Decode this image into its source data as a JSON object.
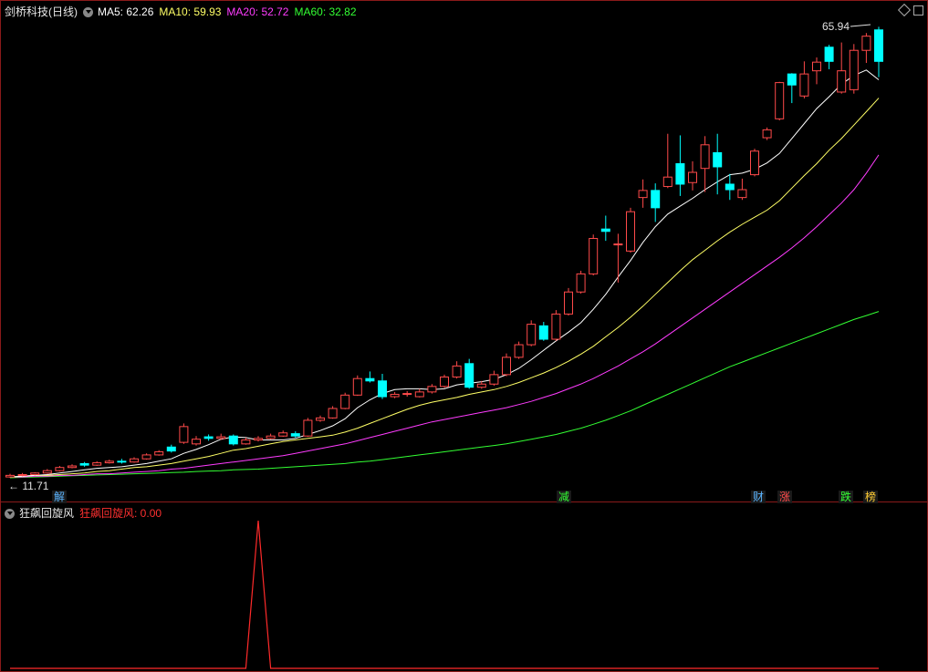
{
  "main": {
    "title": "剑桥科技(日线)",
    "ma5_text": "MA5: 62.26",
    "ma10_text": "MA10: 59.93",
    "ma20_text": "MA20: 52.72",
    "ma60_text": "MA60: 32.82",
    "high_label": "65.94",
    "low_label": "11.71",
    "colors": {
      "up": "#ff4a4a",
      "down": "#00ffff",
      "ma5": "#ffffff",
      "ma10": "#ffff66",
      "ma20": "#ff3cff",
      "ma60": "#33ff33",
      "border": "#8a1a1a"
    }
  },
  "events": [
    {
      "label": "解",
      "color": "#5ab4ff"
    },
    {
      "label": "减",
      "color": "#33ff33"
    },
    {
      "label": "财",
      "color": "#5ab4ff"
    },
    {
      "label": "涨",
      "color": "#ff4a4a"
    },
    {
      "label": "跌",
      "color": "#33ff33"
    },
    {
      "label": "榜",
      "color": "#ffcc33"
    }
  ],
  "sub": {
    "title": "狂飙回旋风",
    "value_text": "狂飙回旋风: 0.00",
    "line_color": "#ff2a2a"
  },
  "chart_data": {
    "type": "candlestick",
    "price_range": [
      11.71,
      65.94
    ],
    "candles": [
      [
        11.8,
        12.0,
        12.2,
        11.7
      ],
      [
        12.0,
        12.1,
        12.3,
        11.9
      ],
      [
        12.1,
        12.3,
        12.4,
        12.0
      ],
      [
        12.3,
        12.6,
        12.8,
        12.2
      ],
      [
        12.6,
        13.0,
        13.2,
        12.5
      ],
      [
        13.0,
        13.2,
        13.4,
        12.9
      ],
      [
        13.5,
        13.3,
        13.7,
        13.1
      ],
      [
        13.3,
        13.6,
        13.8,
        13.2
      ],
      [
        13.6,
        13.8,
        14.0,
        13.5
      ],
      [
        13.8,
        13.7,
        14.1,
        13.5
      ],
      [
        13.7,
        14.1,
        14.3,
        13.6
      ],
      [
        14.1,
        14.6,
        14.8,
        14.0
      ],
      [
        14.6,
        15.0,
        15.2,
        14.5
      ],
      [
        15.6,
        15.1,
        15.9,
        14.9
      ],
      [
        16.2,
        18.2,
        18.6,
        16.0
      ],
      [
        16.0,
        16.6,
        17.0,
        15.8
      ],
      [
        16.9,
        16.7,
        17.2,
        16.4
      ],
      [
        16.7,
        16.9,
        17.3,
        16.5
      ],
      [
        17.0,
        16.0,
        17.2,
        15.8
      ],
      [
        16.0,
        16.5,
        16.8,
        15.9
      ],
      [
        16.5,
        16.7,
        17.0,
        16.3
      ],
      [
        16.7,
        17.0,
        17.3,
        16.6
      ],
      [
        17.0,
        17.4,
        17.7,
        16.9
      ],
      [
        17.3,
        17.0,
        17.6,
        16.8
      ],
      [
        17.0,
        19.0,
        19.3,
        16.9
      ],
      [
        19.0,
        19.3,
        19.6,
        18.8
      ],
      [
        19.3,
        20.5,
        20.8,
        19.2
      ],
      [
        20.5,
        22.2,
        22.5,
        20.4
      ],
      [
        22.2,
        24.3,
        24.7,
        22.1
      ],
      [
        24.3,
        24.0,
        25.2,
        23.8
      ],
      [
        24.0,
        22.0,
        24.9,
        21.7
      ],
      [
        22.0,
        22.3,
        22.6,
        21.8
      ],
      [
        22.3,
        22.4,
        22.7,
        22.0
      ],
      [
        22.0,
        22.6,
        23.0,
        21.9
      ],
      [
        22.6,
        23.3,
        23.6,
        22.4
      ],
      [
        23.3,
        24.5,
        24.8,
        23.1
      ],
      [
        24.5,
        25.9,
        26.5,
        24.3
      ],
      [
        26.2,
        23.2,
        26.8,
        23.0
      ],
      [
        23.2,
        23.6,
        24.0,
        23.0
      ],
      [
        23.6,
        24.8,
        25.3,
        23.4
      ],
      [
        24.8,
        27.0,
        27.5,
        24.6
      ],
      [
        27.0,
        28.6,
        29.0,
        26.8
      ],
      [
        28.6,
        31.2,
        31.7,
        28.4
      ],
      [
        31.0,
        29.3,
        31.5,
        29.1
      ],
      [
        29.3,
        32.5,
        33.0,
        29.1
      ],
      [
        32.5,
        35.3,
        35.8,
        32.3
      ],
      [
        35.3,
        37.6,
        38.0,
        35.1
      ],
      [
        37.6,
        42.1,
        42.6,
        37.4
      ],
      [
        43.3,
        43.0,
        45.0,
        41.8
      ],
      [
        41.3,
        41.4,
        42.7,
        36.5
      ],
      [
        40.5,
        45.5,
        46.0,
        40.3
      ],
      [
        47.3,
        48.2,
        49.6,
        46.0
      ],
      [
        48.2,
        46.0,
        49.1,
        44.2
      ],
      [
        48.7,
        49.9,
        55.4,
        48.5
      ],
      [
        51.6,
        49.0,
        55.2,
        47.5
      ],
      [
        49.2,
        50.5,
        51.9,
        48.2
      ],
      [
        51.0,
        54.0,
        55.1,
        48.0
      ],
      [
        53.0,
        51.2,
        55.4,
        47.7
      ],
      [
        49.0,
        48.3,
        50.3,
        47.0
      ],
      [
        47.3,
        48.3,
        49.7,
        47.0
      ],
      [
        50.2,
        53.2,
        53.5,
        50.0
      ],
      [
        54.9,
        55.9,
        56.2,
        54.6
      ],
      [
        57.3,
        61.9,
        62.0,
        57.1
      ],
      [
        63.0,
        61.6,
        63.1,
        59.3
      ],
      [
        60.2,
        63.0,
        64.6,
        59.9
      ],
      [
        63.4,
        64.5,
        65.1,
        61.7
      ],
      [
        66.4,
        64.6,
        66.7,
        63.6
      ],
      [
        60.7,
        63.4,
        67.0,
        60.5
      ],
      [
        61.0,
        66.0,
        66.8,
        60.5
      ],
      [
        66.0,
        67.8,
        68.2,
        64.4
      ],
      [
        68.6,
        64.6,
        69.0,
        62.6
      ]
    ],
    "ma5": [
      11.8,
      11.9,
      12.0,
      12.1,
      12.3,
      12.5,
      12.7,
      12.9,
      13.0,
      13.1,
      13.3,
      13.5,
      13.8,
      14.1,
      14.8,
      15.3,
      15.9,
      16.6,
      16.9,
      16.8,
      16.5,
      16.5,
      16.5,
      16.7,
      17.2,
      17.7,
      18.3,
      19.2,
      20.6,
      21.6,
      22.4,
      22.9,
      23.0,
      23.0,
      22.9,
      23.0,
      23.5,
      23.7,
      23.9,
      24.2,
      24.8,
      25.6,
      26.7,
      27.9,
      29.1,
      30.2,
      31.4,
      33.1,
      35.0,
      37.2,
      39.3,
      41.6,
      43.6,
      45.2,
      46.2,
      47.2,
      48.3,
      49.3,
      50.2,
      50.4,
      50.9,
      51.7,
      52.9,
      54.8,
      56.7,
      58.6,
      60.1,
      61.7,
      62.8,
      63.5,
      62.26
    ],
    "ma10": [
      11.8,
      11.9,
      12.0,
      12.0,
      12.1,
      12.2,
      12.3,
      12.5,
      12.6,
      12.8,
      13.0,
      13.1,
      13.3,
      13.5,
      13.8,
      14.1,
      14.4,
      14.8,
      15.2,
      15.4,
      15.7,
      16.0,
      16.3,
      16.5,
      16.7,
      16.9,
      17.1,
      17.5,
      18.0,
      18.6,
      19.2,
      19.8,
      20.4,
      20.9,
      21.3,
      21.6,
      21.9,
      22.3,
      22.6,
      22.9,
      23.3,
      23.8,
      24.4,
      25.0,
      25.7,
      26.5,
      27.4,
      28.4,
      29.6,
      30.8,
      32.1,
      33.5,
      35.0,
      36.5,
      38.0,
      39.4,
      40.6,
      41.8,
      42.9,
      43.9,
      44.8,
      45.7,
      46.9,
      48.5,
      50.1,
      51.6,
      53.3,
      54.8,
      56.5,
      58.2,
      59.93
    ],
    "ma20": [
      11.8,
      11.8,
      11.9,
      11.9,
      12.0,
      12.0,
      12.1,
      12.2,
      12.2,
      12.3,
      12.4,
      12.5,
      12.6,
      12.8,
      12.9,
      13.1,
      13.3,
      13.5,
      13.7,
      13.9,
      14.1,
      14.3,
      14.5,
      14.8,
      15.1,
      15.4,
      15.7,
      16.0,
      16.4,
      16.8,
      17.2,
      17.6,
      18.0,
      18.4,
      18.8,
      19.1,
      19.4,
      19.7,
      20.0,
      20.3,
      20.6,
      21.0,
      21.4,
      21.9,
      22.4,
      23.0,
      23.6,
      24.3,
      25.1,
      25.9,
      26.8,
      27.7,
      28.7,
      29.8,
      30.9,
      32.0,
      33.1,
      34.2,
      35.3,
      36.4,
      37.5,
      38.6,
      39.7,
      40.9,
      42.2,
      43.6,
      45.1,
      46.6,
      48.3,
      50.4,
      52.72
    ],
    "ma60": [
      11.7,
      11.75,
      11.8,
      11.85,
      11.9,
      11.95,
      12.0,
      12.05,
      12.1,
      12.15,
      12.2,
      12.25,
      12.3,
      12.35,
      12.4,
      12.5,
      12.55,
      12.6,
      12.7,
      12.75,
      12.8,
      12.9,
      13.0,
      13.1,
      13.2,
      13.3,
      13.4,
      13.5,
      13.7,
      13.8,
      14.0,
      14.2,
      14.4,
      14.6,
      14.8,
      15.0,
      15.2,
      15.4,
      15.6,
      15.8,
      16.0,
      16.3,
      16.6,
      16.9,
      17.2,
      17.6,
      18.0,
      18.5,
      19.0,
      19.6,
      20.2,
      20.9,
      21.6,
      22.3,
      23.0,
      23.7,
      24.4,
      25.1,
      25.8,
      26.4,
      27.0,
      27.6,
      28.2,
      28.8,
      29.4,
      30.0,
      30.6,
      31.2,
      31.8,
      32.3,
      32.82
    ],
    "indicator": {
      "name": "狂飙回旋风",
      "values": [
        0,
        0,
        0,
        0,
        0,
        0,
        0,
        0,
        0,
        0,
        0,
        0,
        0,
        0,
        0,
        0,
        0,
        0,
        0,
        0,
        1,
        0,
        0,
        0,
        0,
        0,
        0,
        0,
        0,
        0,
        0,
        0,
        0,
        0,
        0,
        0,
        0,
        0,
        0,
        0,
        0,
        0,
        0,
        0,
        0,
        0,
        0,
        0,
        0,
        0,
        0,
        0,
        0,
        0,
        0,
        0,
        0,
        0,
        0,
        0,
        0,
        0,
        0,
        0,
        0,
        0,
        0,
        0,
        0,
        0,
        0
      ],
      "ylim": [
        0,
        1
      ]
    }
  }
}
